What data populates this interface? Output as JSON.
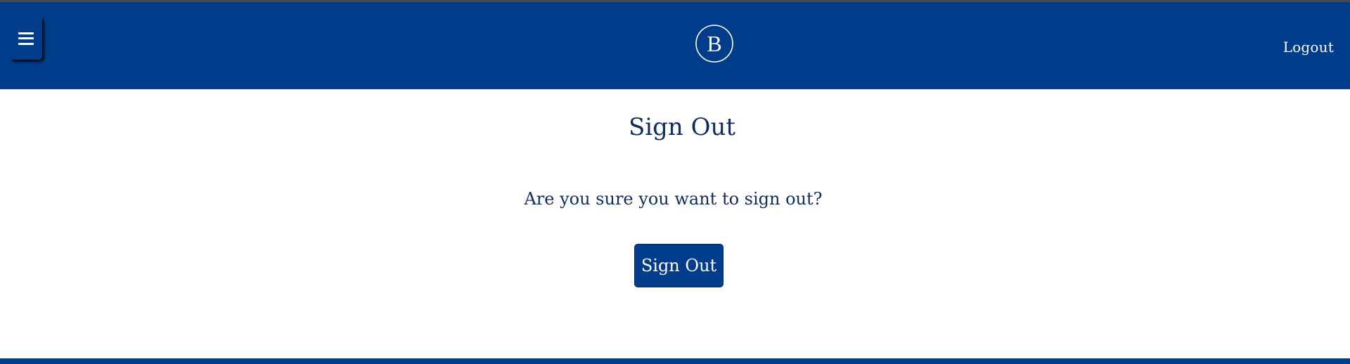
{
  "header": {
    "menu_icon": "hamburger-icon",
    "logo_letter": "B",
    "logout_label": "Logout"
  },
  "main": {
    "title": "Sign Out",
    "prompt": "Are you sure you want to sign out?",
    "signout_button_label": "Sign Out"
  },
  "colors": {
    "brand_blue": "#023d8c",
    "text_navy": "#0f2c5e",
    "background": "#ffffff"
  }
}
